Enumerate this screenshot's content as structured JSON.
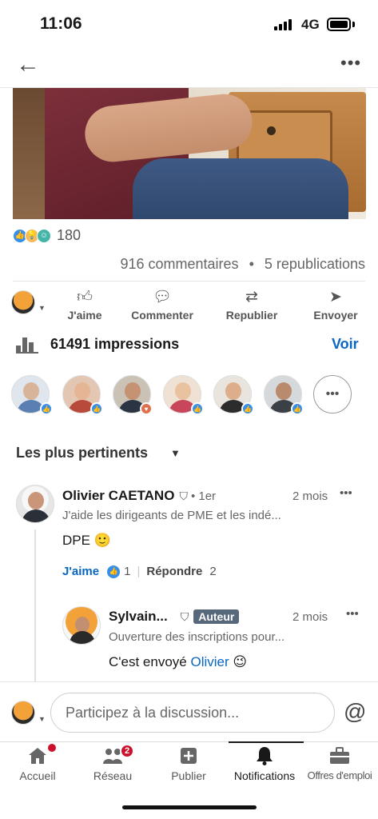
{
  "status": {
    "time": "11:06",
    "network": "4G"
  },
  "post": {
    "reaction_count": "180",
    "comments": "916 commentaires",
    "separator": "•",
    "reposts": "5 republications"
  },
  "actions": [
    {
      "label": "J'aime",
      "icon": "thumbs-up-icon"
    },
    {
      "label": "Commenter",
      "icon": "comment-icon"
    },
    {
      "label": "Republier",
      "icon": "repost-icon"
    },
    {
      "label": "Envoyer",
      "icon": "send-icon"
    }
  ],
  "impressions": {
    "text": "61491 impressions",
    "link": "Voir"
  },
  "sort_label": "Les plus pertinents",
  "comment1": {
    "name": "Olivier CAETANO",
    "degree": "• 1er",
    "time": "2 mois",
    "headline": "J'aide les dirigeants de PME et les indé...",
    "body": "DPE 🙂",
    "like_label": "J'aime",
    "like_count": "1",
    "reply_label": "Répondre",
    "reply_count": "2"
  },
  "reply1": {
    "name": "Sylvain...",
    "author_badge": "Auteur",
    "time": "2 mois",
    "headline": "Ouverture des inscriptions pour...",
    "body_prefix": "C'est envoyé",
    "mention": "Olivier",
    "emoji": "😉"
  },
  "composer": {
    "placeholder": "Participez à la discussion..."
  },
  "tabs": [
    {
      "label": "Accueil",
      "badge": ""
    },
    {
      "label": "Réseau",
      "badge": "2"
    },
    {
      "label": "Publier",
      "badge": ""
    },
    {
      "label": "Notifications",
      "badge": ""
    },
    {
      "label": "Offres d'emploi",
      "badge": ""
    }
  ],
  "colors": {
    "brand_blue": "#0a66c2",
    "badge_red": "#cb112d"
  }
}
